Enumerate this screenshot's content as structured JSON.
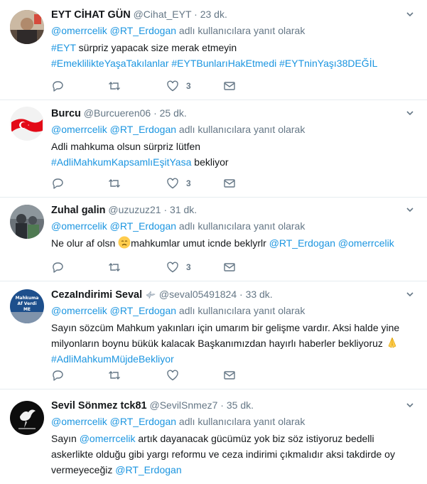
{
  "tweets": [
    {
      "name": "EYT CİHAT GÜN",
      "handle": "@Cihat_EYT",
      "sep": "·",
      "time": "23 dk.",
      "reply_users": [
        "@omerrcelik",
        "@RT_Erdogan"
      ],
      "reply_suffix": "adlı kullanıcılara yanıt olarak",
      "line1_link": "#EYT",
      "line1_text": " sürpriz yapacak size merak etmeyin",
      "line2_tags": [
        "#EmeklilikteYaşaTakılanlar",
        "#EYTBunlarıHakEtmedi",
        "#EYTninYaşı38DEĞİL"
      ],
      "likes": "3"
    },
    {
      "name": "Burcu",
      "handle": "@Burcueren06",
      "sep": "·",
      "time": "25 dk.",
      "reply_users": [
        "@omerrcelik",
        "@RT_Erdogan"
      ],
      "reply_suffix": "adlı kullanıcılara yanıt olarak",
      "line1": "Adli mahkuma olsun sürpriz lütfen",
      "line2_link": "#AdliMahkumKapsamlıEşitYasa",
      "line2_text": " bekliyor",
      "likes": "3"
    },
    {
      "name": "Zuhal galin",
      "handle": "@uzuzuz21",
      "sep": "·",
      "time": "31 dk.",
      "reply_users": [
        "@omerrcelik",
        "@RT_Erdogan"
      ],
      "reply_suffix": "adlı kullanıcılara yanıt olarak",
      "text_a": "Ne olur af olsn ",
      "text_b": "mahkumlar umut icnde beklyrlr ",
      "mentions": [
        "@RT_Erdogan",
        "@omerrcelik"
      ],
      "likes": "3"
    },
    {
      "name": "CezaIndirimi Seval",
      "handle": "@seval05491824",
      "sep": "·",
      "time": "33 dk.",
      "reply_users": [
        "@omerrcelik",
        "@RT_Erdogan"
      ],
      "reply_suffix": "adlı kullanıcılara yanıt olarak",
      "line1": "Sayın sözcüm Mahkum yakınları için umarım bir gelişme vardır. Aksi halde yine",
      "line2": "milyonların boynu bükük kalacak Başkanımızdan hayırlı haberler bekliyoruz",
      "line3_link": "#AdliMahkumMüjdeBekliyor",
      "avatar_text_1": "Mahkuma",
      "avatar_text_2": "Af Verdi",
      "avatar_text_3": "ME",
      "likes": ""
    },
    {
      "name": "Sevil Sönmez tck81",
      "handle": "@SevilSnmez7",
      "sep": "·",
      "time": "35 dk.",
      "reply_users": [
        "@omerrcelik",
        "@RT_Erdogan"
      ],
      "reply_suffix": "adlı kullanıcılara yanıt olarak",
      "l1_a": "Sayın ",
      "l1_mention": "@omerrcelik",
      "l1_b": " artık dayanacak gücümüz yok biz söz istiyoruz bedelli",
      "line2": "askerlikte olduğu gibi yargı reformu ve ceza indirimi çıkmalıdır aksi takdirde oy",
      "l3_a": "vermeyeceğiz ",
      "l3_mention": "@RT_Erdogan"
    }
  ]
}
